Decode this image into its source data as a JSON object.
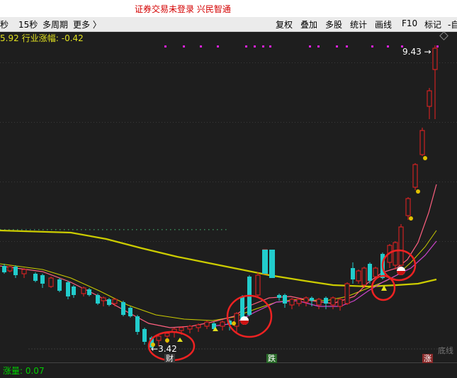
{
  "topbar": {
    "notice": "证券交易未登录  兴民智通"
  },
  "toolbar": {
    "left_items": [
      "秒",
      "15秒",
      "多周期",
      "更多 〉"
    ],
    "right_items": [
      "复权",
      "叠加",
      "多股",
      "统计",
      "画线",
      "F10",
      "标记",
      "-自"
    ]
  },
  "infobar": {
    "value": "5.92",
    "label": "行业涨幅:",
    "change": "-0.42"
  },
  "chart": {
    "high_label": "9.43",
    "low_label": "3.42",
    "low_marker": "←",
    "high_marker": "→",
    "bottom_line_label": "底线",
    "volume_label": "涨量: 0.07",
    "tag_cai": "财",
    "tag_die": "跌",
    "tag_zhang": "涨"
  },
  "colors": {
    "up": "#ee2222",
    "down": "#22cccc",
    "ma_yellow": "#cccc00",
    "ma_pink": "#ff6080",
    "ma_magenta": "#cc44cc",
    "circle": "#ee2222",
    "dotline": "#3a8a5a"
  }
}
